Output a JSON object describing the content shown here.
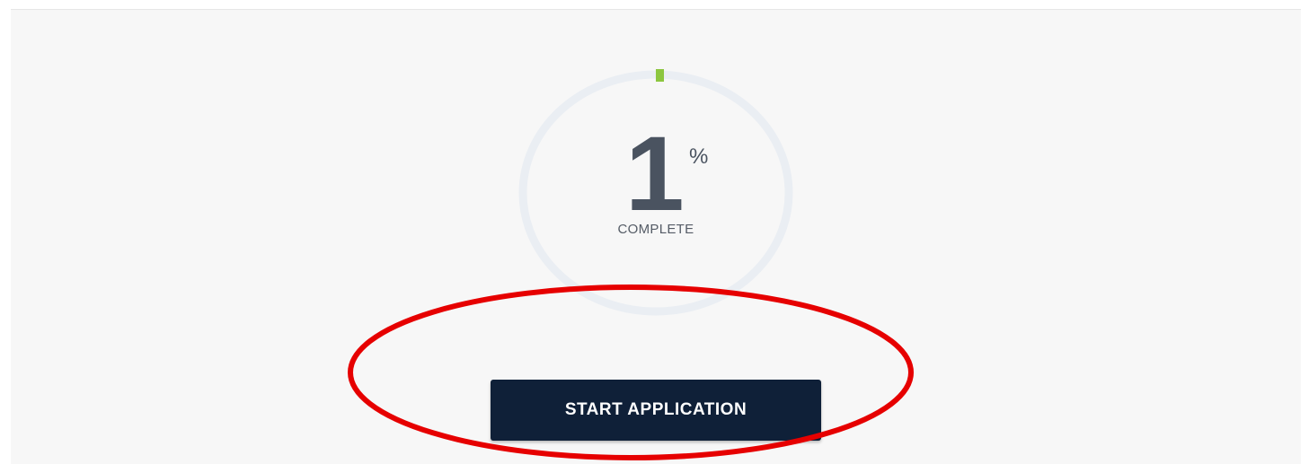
{
  "progress": {
    "percent_value": "1",
    "percent_fraction": 0.01,
    "percent_symbol": "%",
    "label": "COMPLETE",
    "track_color": "#eaeef3",
    "fill_color": "#8cc63f"
  },
  "actions": {
    "start_label": "START APPLICATION",
    "button_color": "#0f2038"
  },
  "annotation": {
    "highlight_color": "#e60000"
  }
}
